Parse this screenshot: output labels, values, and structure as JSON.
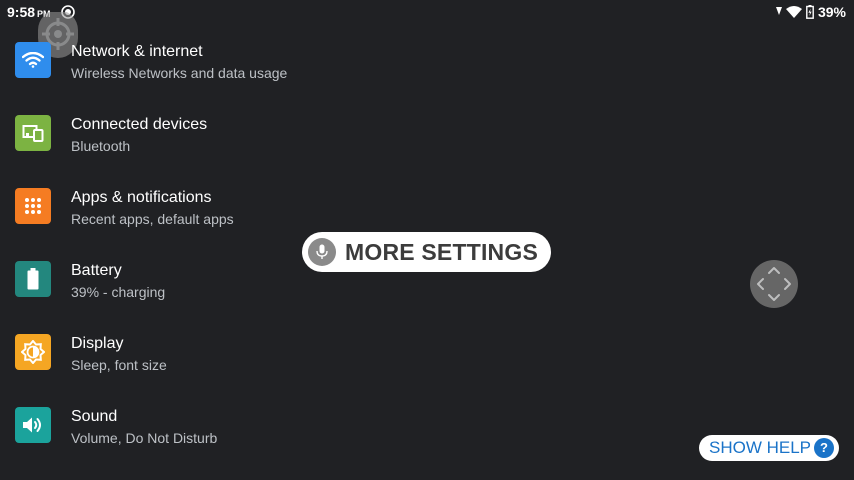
{
  "status_bar": {
    "time": "9:58",
    "ampm": "PM",
    "battery_percent": "39%",
    "icons": [
      "notification-icon",
      "signal-icon",
      "wifi-icon",
      "battery-charging-icon"
    ]
  },
  "settings": [
    {
      "title": "Network & internet",
      "subtitle": "Wireless Networks and data usage",
      "icon": "wifi-icon",
      "color": "#2f8ded"
    },
    {
      "title": "Connected devices",
      "subtitle": "Bluetooth",
      "icon": "devices-icon",
      "color": "#7cb342"
    },
    {
      "title": "Apps & notifications",
      "subtitle": "Recent apps, default apps",
      "icon": "apps-grid-icon",
      "color": "#f57c22"
    },
    {
      "title": "Battery",
      "subtitle": "39% - charging",
      "icon": "battery-icon",
      "color": "#23877e"
    },
    {
      "title": "Display",
      "subtitle": "Sleep, font size",
      "icon": "brightness-icon",
      "color": "#f5a623"
    },
    {
      "title": "Sound",
      "subtitle": "Volume, Do Not Disturb",
      "icon": "volume-icon",
      "color": "#1ba39c"
    }
  ],
  "voice_overlay": {
    "label": "MORE SETTINGS",
    "icon": "microphone-icon"
  },
  "nav_overlay": {
    "icon": "dpad-arrows-icon"
  },
  "help": {
    "label": "SHOW HELP",
    "badge": "?",
    "color": "#1a73c8"
  }
}
